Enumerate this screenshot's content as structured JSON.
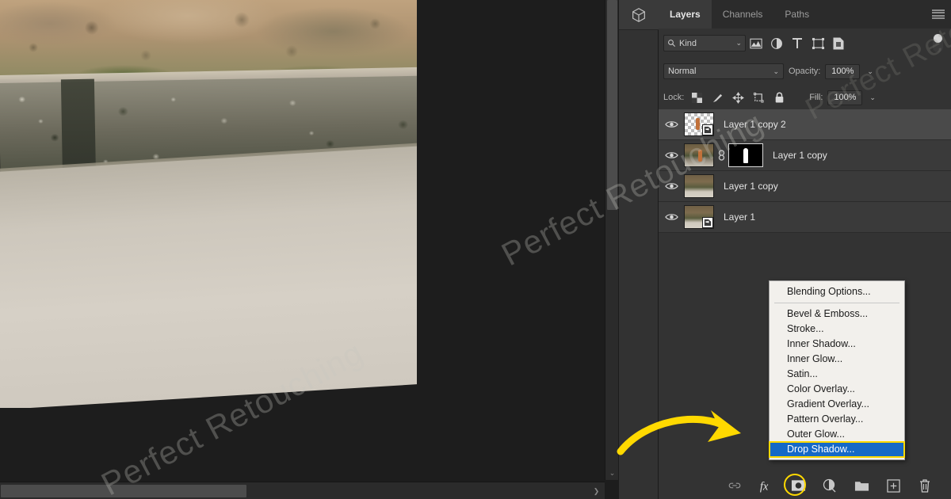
{
  "app": {
    "watermark": "Perfect Retouching"
  },
  "canvas": {
    "name": "document-canvas",
    "vertical_scrollbar_arrow": "⌄",
    "horizontal_scrollbar_arrow": "❯"
  },
  "dock": {
    "collapsed_tab_icon": "3d-cube-icon"
  },
  "panel": {
    "tabs": [
      {
        "label": "Layers",
        "active": true
      },
      {
        "label": "Channels",
        "active": false
      },
      {
        "label": "Paths",
        "active": false
      }
    ],
    "menu_icon": "hamburger-menu-icon",
    "filter": {
      "kind_label": "Kind",
      "search_icon": "search-icon",
      "dropdown_caret": "⌄",
      "icons": [
        "pixel-layer-filter-icon",
        "adjustment-layer-filter-icon",
        "type-layer-filter-icon",
        "shape-layer-filter-icon",
        "smart-object-filter-icon"
      ],
      "toggle": "filter-enable-toggle"
    },
    "blend": {
      "mode": "Normal",
      "opacity_label": "Opacity:",
      "opacity_value": "100%",
      "fill_label": "Fill:",
      "fill_value": "100%",
      "caret": "⌄"
    },
    "lock": {
      "label": "Lock:",
      "icons": [
        "lock-transparent-pixels-icon",
        "lock-image-pixels-icon",
        "lock-position-icon",
        "lock-artboard-nesting-icon",
        "lock-all-icon"
      ]
    },
    "layers": [
      {
        "name": "Layer 1 copy 2",
        "visible": true,
        "selected": true,
        "thumb": "transparent-checker",
        "smart_object": true,
        "has_mask": false,
        "linked": false
      },
      {
        "name": "Layer 1 copy",
        "visible": true,
        "selected": false,
        "thumb": "photo",
        "smart_object": false,
        "has_mask": true,
        "linked": true
      },
      {
        "name": "Layer 1 copy",
        "visible": true,
        "selected": false,
        "thumb": "photo",
        "smart_object": false,
        "has_mask": false,
        "linked": false
      },
      {
        "name": "Layer 1",
        "visible": true,
        "selected": false,
        "thumb": "photo",
        "smart_object": true,
        "has_mask": false,
        "linked": false
      }
    ],
    "bottom_tools": [
      {
        "icon": "link-layers-icon",
        "label": "Link layers"
      },
      {
        "icon": "fx-icon",
        "label": "fx",
        "highlighted": true
      },
      {
        "icon": "add-layer-mask-icon",
        "label": "Add layer mask"
      },
      {
        "icon": "new-adjustment-layer-icon",
        "label": "New adjustment layer"
      },
      {
        "icon": "new-group-icon",
        "label": "New group"
      },
      {
        "icon": "new-layer-icon",
        "label": "New layer"
      },
      {
        "icon": "delete-layer-icon",
        "label": "Delete layer"
      }
    ]
  },
  "context_menu": {
    "name": "layer-style-menu",
    "header_item": "Blending Options...",
    "items": [
      {
        "label": "Bevel & Emboss...",
        "selected": false
      },
      {
        "label": "Stroke...",
        "selected": false
      },
      {
        "label": "Inner Shadow...",
        "selected": false
      },
      {
        "label": "Inner Glow...",
        "selected": false
      },
      {
        "label": "Satin...",
        "selected": false
      },
      {
        "label": "Color Overlay...",
        "selected": false
      },
      {
        "label": "Gradient Overlay...",
        "selected": false
      },
      {
        "label": "Pattern Overlay...",
        "selected": false
      },
      {
        "label": "Outer Glow...",
        "selected": false
      },
      {
        "label": "Drop Shadow...",
        "selected": true
      }
    ]
  },
  "annotations": {
    "arrow_color": "#ffd900",
    "highlight_color": "#ffd900",
    "selection_color": "#1569c7"
  }
}
